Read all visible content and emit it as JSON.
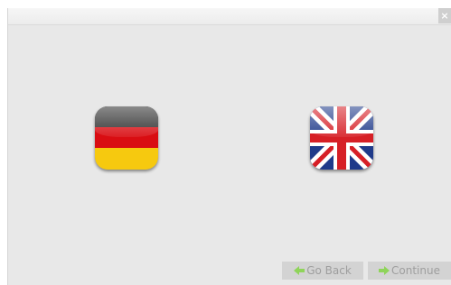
{
  "window": {
    "close_glyph": "×"
  },
  "languages": [
    {
      "name": "german-flag-icon"
    },
    {
      "name": "uk-flag-icon"
    }
  ],
  "footer": {
    "back_label": "Go Back",
    "continue_label": "Continue",
    "arrow_color": "#8fd45a"
  }
}
